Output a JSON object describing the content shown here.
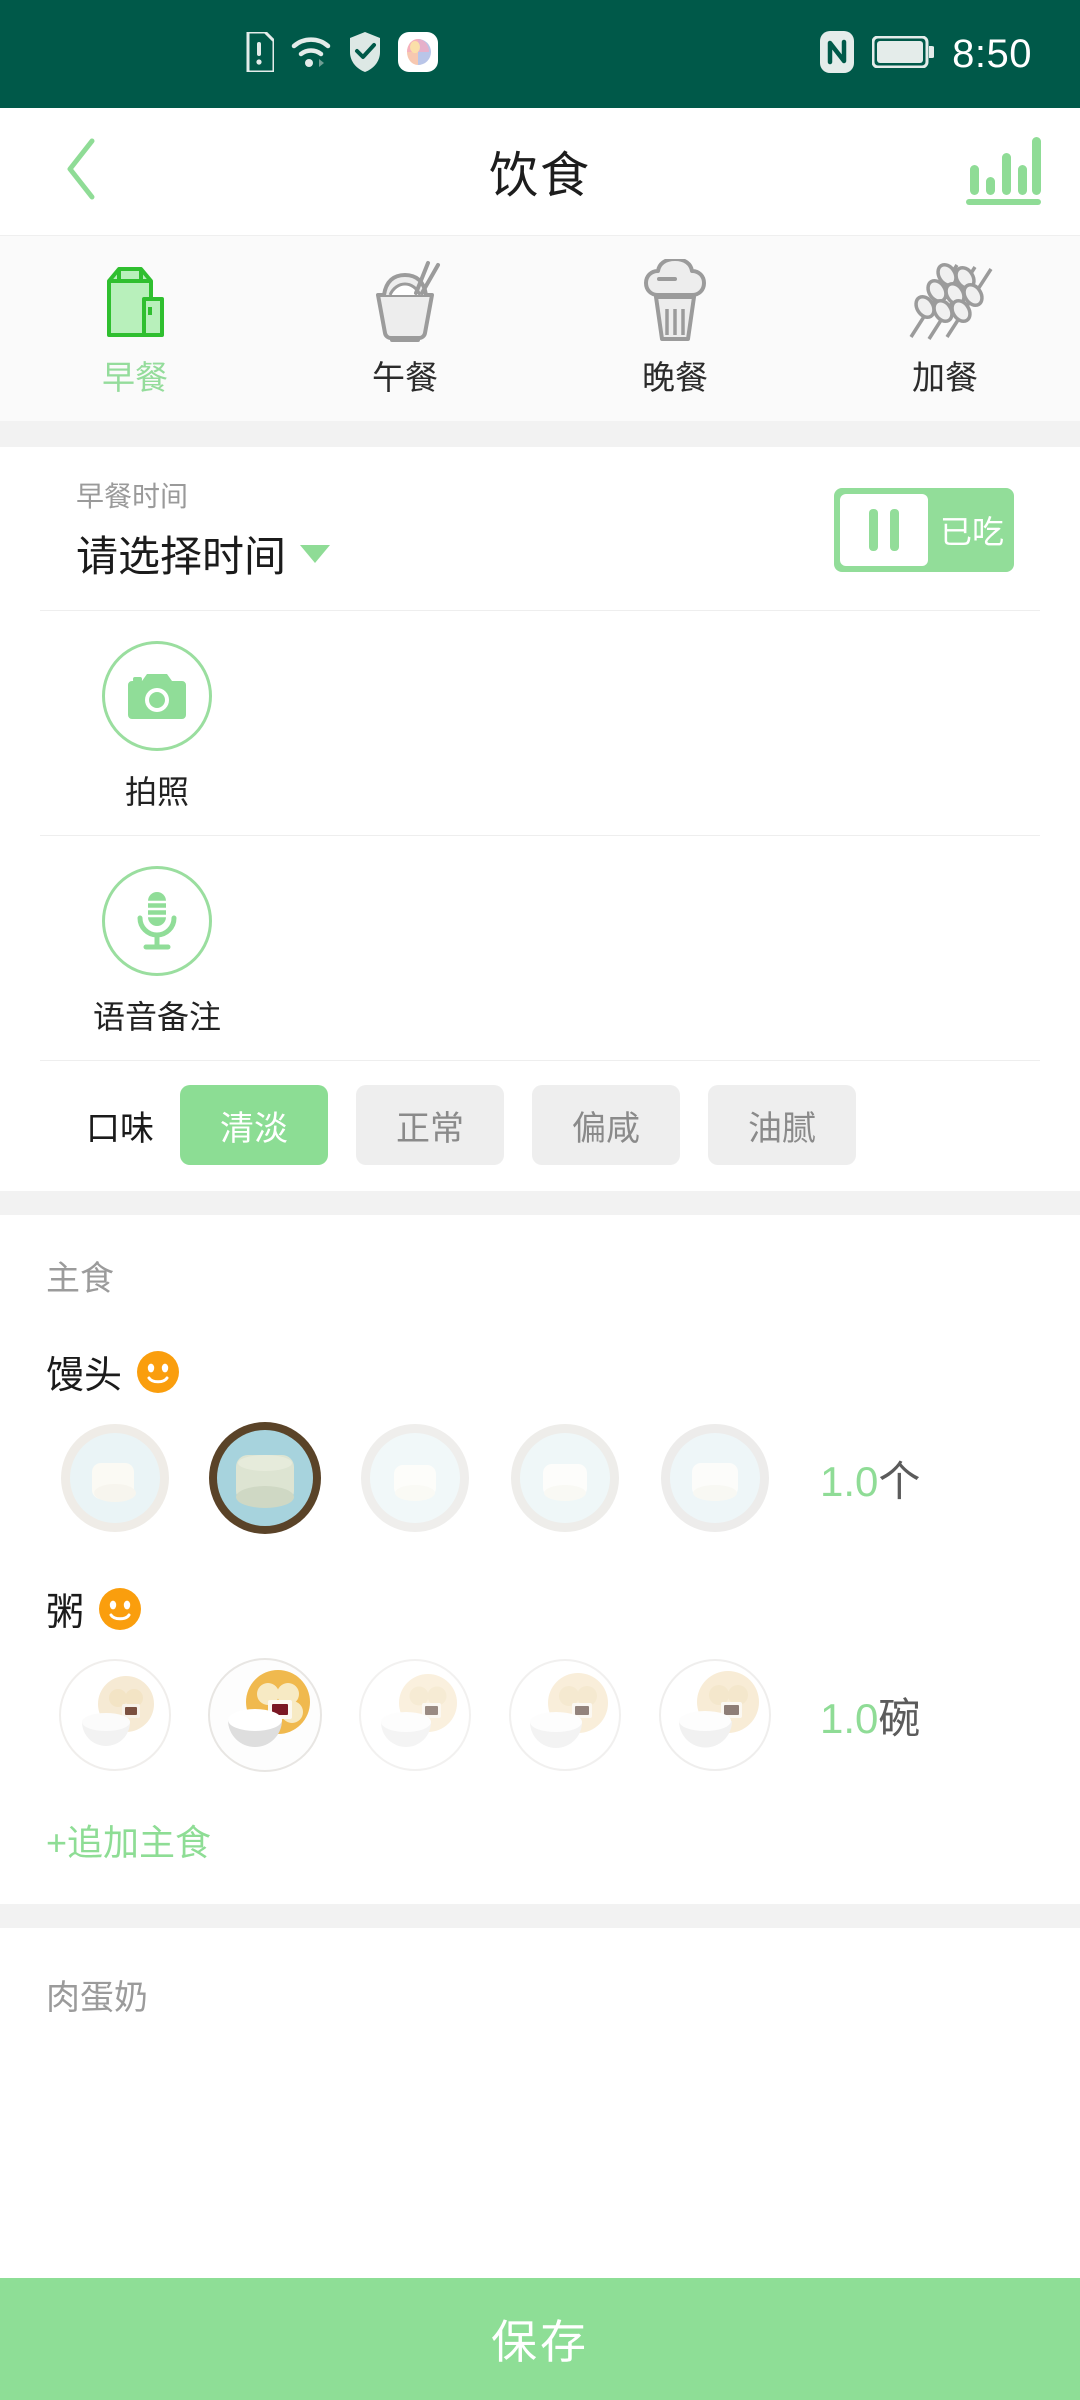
{
  "status_bar": {
    "time": "8:50",
    "left_icons": [
      "sim-alert-icon",
      "wifi-icon",
      "shield-check-icon",
      "app-color-icon"
    ],
    "right_icons": [
      "nfc-icon",
      "battery-icon"
    ],
    "background_color": "#005949"
  },
  "header": {
    "title": "饮食",
    "back_icon": "chevron-left-icon",
    "chart_icon": "bar-chart-icon",
    "accent_color": "#8fdc96"
  },
  "meal_tabs": [
    {
      "label": "早餐",
      "icon": "milk-carton-icon",
      "active": true
    },
    {
      "label": "午餐",
      "icon": "rice-bowl-icon",
      "active": false
    },
    {
      "label": "晚餐",
      "icon": "cupcake-icon",
      "active": false
    },
    {
      "label": "加餐",
      "icon": "wheat-skewer-icon",
      "active": false
    }
  ],
  "time_row": {
    "label": "早餐时间",
    "value": "请选择时间",
    "caret_icon": "caret-down-icon",
    "toggle": {
      "label": "已吃",
      "state": "on",
      "knob_icon": "pause-bars-icon"
    }
  },
  "actions": [
    {
      "label": "拍照",
      "icon": "camera-icon"
    },
    {
      "label": "语音备注",
      "icon": "microphone-icon"
    }
  ],
  "taste": {
    "title": "口味",
    "options": [
      {
        "label": "清淡",
        "selected": true
      },
      {
        "label": "正常",
        "selected": false
      },
      {
        "label": "偏咸",
        "selected": false
      },
      {
        "label": "油腻",
        "selected": false
      }
    ],
    "selected_color": "#8cdd94"
  },
  "staple_section": {
    "title": "主食",
    "items": [
      {
        "name": "馒头",
        "mood_icon": "smiley-face-icon",
        "quantity": "1.0",
        "unit": "个",
        "selected_index": 1,
        "portion_icon": "steamed-bun-plate-icon",
        "portion_count": 5
      },
      {
        "name": "粥",
        "mood_icon": "smiley-face-icon",
        "quantity": "1.0",
        "unit": "碗",
        "selected_index": 1,
        "portion_icon": "rice-bowl-dumpling-icon",
        "portion_count": 5
      }
    ],
    "add_link": "+追加主食"
  },
  "protein_section": {
    "title": "肉蛋奶"
  },
  "save_bar": {
    "label": "保存",
    "color": "#8ede96"
  }
}
